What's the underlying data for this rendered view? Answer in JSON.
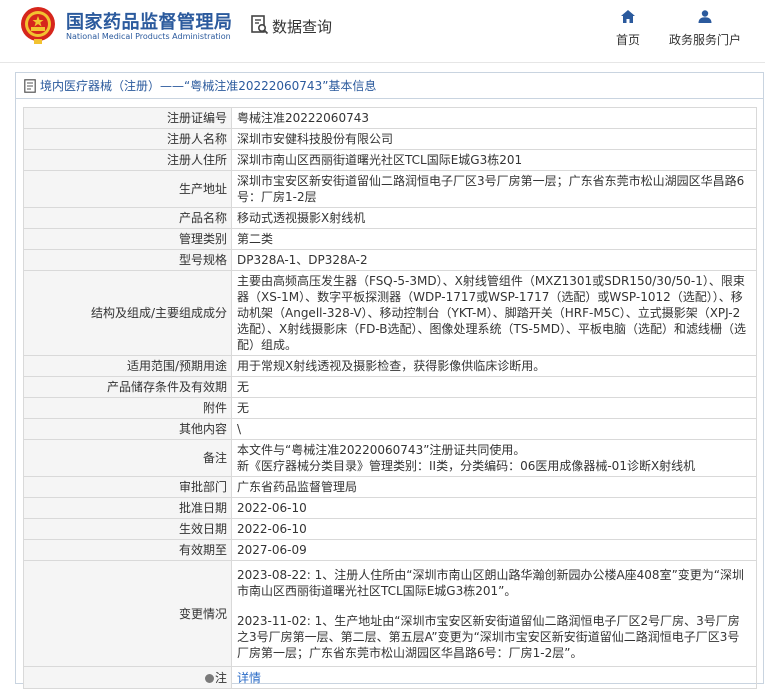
{
  "header": {
    "site_title": "国家药品监督管理局",
    "site_subtitle": "National Medical Products Administration",
    "query_title": "数据查询",
    "nav": [
      {
        "label": "首页",
        "icon": "home-icon"
      },
      {
        "label": "政务服务门户",
        "icon": "user-icon"
      }
    ],
    "brand_color": "#2b5a9d"
  },
  "panel": {
    "title": "境内医疗器械（注册）——“粤械注准20222060743”基本信息"
  },
  "rows": [
    {
      "label": "注册证编号",
      "value": "粤械注准20222060743"
    },
    {
      "label": "注册人名称",
      "value": "深圳市安健科技股份有限公司"
    },
    {
      "label": "注册人住所",
      "value": "深圳市南山区西丽街道曙光社区TCL国际E城G3栋201"
    },
    {
      "label": "生产地址",
      "value": "深圳市宝安区新安街道留仙二路润恒电子厂区3号厂房第一层；广东省东莞市松山湖园区华昌路6号：厂房1-2层"
    },
    {
      "label": "产品名称",
      "value": "移动式透视摄影X射线机"
    },
    {
      "label": "管理类别",
      "value": "第二类"
    },
    {
      "label": "型号规格",
      "value": "DP328A-1、DP328A-2"
    },
    {
      "label": "结构及组成/主要组成成分",
      "value": "主要由高频高压发生器（FSQ-5-3MD）、X射线管组件（MXZ1301或SDR150/30/50-1）、限束器（XS-1M）、数字平板探测器（WDP-1717或WSP-1717（选配）或WSP-1012（选配））、移动机架（Angell-328-V）、移动控制台（YKT-M）、脚踏开关（HRF-M5C）、立式摄影架（XPJ-2选配）、X射线摄影床（FD-B选配）、图像处理系统（TS-5MD）、平板电脑（选配）和滤线栅（选配）组成。"
    },
    {
      "label": "适用范围/预期用途",
      "value": "用于常规X射线透视及摄影检查，获得影像供临床诊断用。"
    },
    {
      "label": "产品储存条件及有效期",
      "value": "无"
    },
    {
      "label": "附件",
      "value": "无"
    },
    {
      "label": "其他内容",
      "value": "\\"
    },
    {
      "label": "备注",
      "value_lines": [
        "本文件与“粤械注准20220060743”注册证共同使用。",
        "新《医疗器械分类目录》管理类别：II类，分类编码：06医用成像器械-01诊断X射线机"
      ]
    },
    {
      "label": "审批部门",
      "value": "广东省药品监督管理局"
    },
    {
      "label": "批准日期",
      "value": "2022-06-10"
    },
    {
      "label": "生效日期",
      "value": "2022-06-10"
    },
    {
      "label": "有效期至",
      "value": "2027-06-09"
    },
    {
      "label": "变更情况",
      "value_lines": [
        "2023-08-22: 1、注册人住所由“深圳市南山区朗山路华瀚创新园办公楼A座408室”变更为“深圳市南山区西丽街道曙光社区TCL国际E城G3栋201”。",
        "",
        "2023-11-02: 1、生产地址由“深圳市宝安区新安街道留仙二路润恒电子厂区2号厂房、3号厂房之3号厂房第一层、第二层、第五层A”变更为“深圳市宝安区新安街道留仙二路润恒电子厂区3号厂房第一层；广东省东莞市松山湖园区华昌路6号：厂房1-2层”。"
      ]
    },
    {
      "label": "注",
      "value": "详情",
      "is_link": true
    }
  ]
}
